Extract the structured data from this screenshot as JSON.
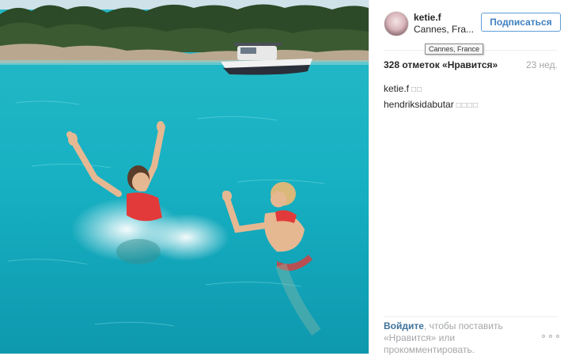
{
  "post": {
    "username": "ketie.f",
    "location": "Cannes, Fra...",
    "location_tooltip": "Cannes, France",
    "follow_label": "Подписаться",
    "likes_text": "328 отметок «Нравится»",
    "time_ago": "23 нед.",
    "comments": [
      {
        "user": "ketie.f",
        "text": "□□"
      },
      {
        "user": "hendriksidabutar",
        "text": "□□□□"
      }
    ],
    "login_link": "Войдите",
    "login_text": ", чтобы поставить «Нравится» или прокомментировать."
  },
  "photo": {
    "description_icon": "photo-image",
    "colors": {
      "water": "#17b3c4",
      "trees": "#2f4a2a",
      "rocks": "#b9a88f",
      "boat": "#f2f2f2",
      "swimsuit": "#e23a3a"
    }
  },
  "colors": {
    "accent": "#3f7fbf",
    "link": "#3f729b",
    "muted": "#a5a7aa"
  }
}
